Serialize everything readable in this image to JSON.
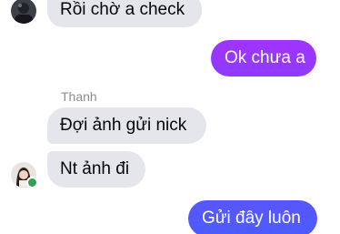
{
  "conversation": {
    "messages": [
      {
        "sender": "other",
        "text": "Rồi chờ a check"
      },
      {
        "sender": "me",
        "text": "Ok chưa a"
      },
      {
        "sender": "other",
        "text": "Đợi ảnh gửi nick",
        "name": "Thanh"
      },
      {
        "sender": "other",
        "text": "Nt ảnh đi"
      },
      {
        "sender": "me",
        "text": "Gửi đây luôn"
      }
    ]
  },
  "colors": {
    "incoming_bubble": "#e4e6eb",
    "outgoing_gradient_top": "#a033ff",
    "outgoing_gradient_bottom": "#4a5cff",
    "online_indicator": "#31a24c"
  },
  "icons": {
    "avatar_top": "user-avatar-icon",
    "avatar_bottom": "user-avatar-icon"
  }
}
